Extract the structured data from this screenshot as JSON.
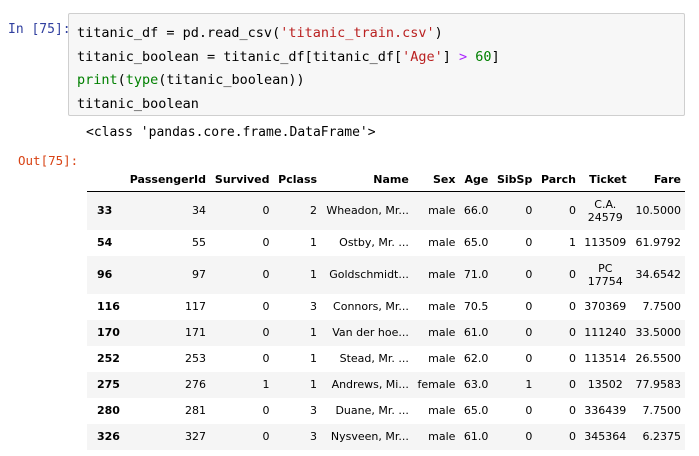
{
  "cell_in": {
    "prompt": "In [75]:",
    "lines": [
      [
        {
          "t": "titanic_df = pd.read_csv(",
          "c": ""
        },
        {
          "t": "'titanic_train.csv'",
          "c": "str"
        },
        {
          "t": ")",
          "c": ""
        }
      ],
      [
        {
          "t": "titanic_boolean = titanic_df[titanic_df[",
          "c": ""
        },
        {
          "t": "'Age'",
          "c": "str"
        },
        {
          "t": "] ",
          "c": ""
        },
        {
          "t": ">",
          "c": "op"
        },
        {
          "t": " ",
          "c": ""
        },
        {
          "t": "60",
          "c": "num"
        },
        {
          "t": "]",
          "c": ""
        }
      ],
      [
        {
          "t": "print",
          "c": "bi"
        },
        {
          "t": "(",
          "c": ""
        },
        {
          "t": "type",
          "c": "bi"
        },
        {
          "t": "(titanic_boolean))",
          "c": ""
        }
      ],
      [
        {
          "t": "titanic_boolean",
          "c": ""
        }
      ]
    ]
  },
  "stdout": "<class 'pandas.core.frame.DataFrame'>",
  "cell_out": {
    "prompt": "Out[75]:"
  },
  "table": {
    "columns": [
      "",
      "PassengerId",
      "Survived",
      "Pclass",
      "Name",
      "Sex",
      "Age",
      "SibSp",
      "Parch",
      "Ticket",
      "Fare"
    ],
    "rows": [
      {
        "idx": "33",
        "cells": [
          "34",
          "0",
          "2",
          "Wheadon, Mr...",
          "male",
          "66.0",
          "0",
          "0",
          "C.A.\n24579",
          "10.5000"
        ],
        "tall": true
      },
      {
        "idx": "54",
        "cells": [
          "55",
          "0",
          "1",
          "Ostby, Mr. ...",
          "male",
          "65.0",
          "0",
          "1",
          "113509",
          "61.9792"
        ],
        "tall": false
      },
      {
        "idx": "96",
        "cells": [
          "97",
          "0",
          "1",
          "Goldschmidt...",
          "male",
          "71.0",
          "0",
          "0",
          "PC\n17754",
          "34.6542"
        ],
        "tall": true
      },
      {
        "idx": "116",
        "cells": [
          "117",
          "0",
          "3",
          "Connors, Mr...",
          "male",
          "70.5",
          "0",
          "0",
          "370369",
          "7.7500"
        ],
        "tall": false
      },
      {
        "idx": "170",
        "cells": [
          "171",
          "0",
          "1",
          "Van der hoe...",
          "male",
          "61.0",
          "0",
          "0",
          "111240",
          "33.5000"
        ],
        "tall": false
      },
      {
        "idx": "252",
        "cells": [
          "253",
          "0",
          "1",
          "Stead, Mr. ...",
          "male",
          "62.0",
          "0",
          "0",
          "113514",
          "26.5500"
        ],
        "tall": false
      },
      {
        "idx": "275",
        "cells": [
          "276",
          "1",
          "1",
          "Andrews, Mi...",
          "female",
          "63.0",
          "1",
          "0",
          "13502",
          "77.9583"
        ],
        "tall": false
      },
      {
        "idx": "280",
        "cells": [
          "281",
          "0",
          "3",
          "Duane, Mr. ...",
          "male",
          "65.0",
          "0",
          "0",
          "336439",
          "7.7500"
        ],
        "tall": false
      },
      {
        "idx": "326",
        "cells": [
          "327",
          "0",
          "3",
          "Nysveen, Mr...",
          "male",
          "61.0",
          "0",
          "0",
          "345364",
          "6.2375"
        ],
        "tall": false
      }
    ]
  }
}
